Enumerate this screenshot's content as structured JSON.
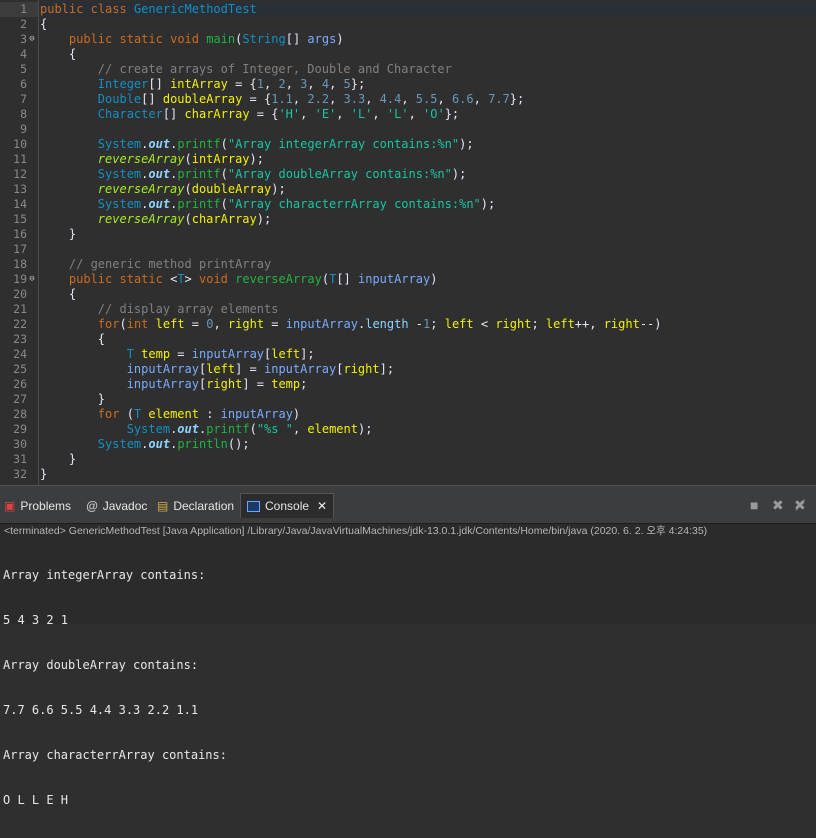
{
  "editor": {
    "lines": [
      {
        "n": "1",
        "tokens": [
          [
            "kw",
            "public"
          ],
          [
            "plain",
            " "
          ],
          [
            "kw",
            "class"
          ],
          [
            "plain",
            " "
          ],
          [
            "cls",
            "GenericMethodTest"
          ]
        ]
      },
      {
        "n": "2",
        "tokens": [
          [
            "plain",
            "{"
          ]
        ]
      },
      {
        "n": "3",
        "fold": "⊖",
        "tokens": [
          [
            "plain",
            "    "
          ],
          [
            "kw",
            "public"
          ],
          [
            "plain",
            " "
          ],
          [
            "kw",
            "static"
          ],
          [
            "plain",
            " "
          ],
          [
            "kw",
            "void"
          ],
          [
            "plain",
            " "
          ],
          [
            "fn",
            "main"
          ],
          [
            "plain",
            "("
          ],
          [
            "cls",
            "String"
          ],
          [
            "plain",
            "[] "
          ],
          [
            "par",
            "args"
          ],
          [
            "plain",
            ")"
          ]
        ]
      },
      {
        "n": "4",
        "tokens": [
          [
            "plain",
            "    {"
          ]
        ]
      },
      {
        "n": "5",
        "tokens": [
          [
            "plain",
            "        "
          ],
          [
            "cmt",
            "// create arrays of Integer, Double and Character"
          ]
        ]
      },
      {
        "n": "6",
        "tokens": [
          [
            "plain",
            "        "
          ],
          [
            "cls",
            "Integer"
          ],
          [
            "plain",
            "[] "
          ],
          [
            "var",
            "intArray"
          ],
          [
            "plain",
            " = {"
          ],
          [
            "num",
            "1"
          ],
          [
            "plain",
            ", "
          ],
          [
            "num",
            "2"
          ],
          [
            "plain",
            ", "
          ],
          [
            "num",
            "3"
          ],
          [
            "plain",
            ", "
          ],
          [
            "num",
            "4"
          ],
          [
            "plain",
            ", "
          ],
          [
            "num",
            "5"
          ],
          [
            "plain",
            "};"
          ]
        ]
      },
      {
        "n": "7",
        "tokens": [
          [
            "plain",
            "        "
          ],
          [
            "cls",
            "Double"
          ],
          [
            "plain",
            "[] "
          ],
          [
            "var",
            "doubleArray"
          ],
          [
            "plain",
            " = {"
          ],
          [
            "num",
            "1.1"
          ],
          [
            "plain",
            ", "
          ],
          [
            "num",
            "2.2"
          ],
          [
            "plain",
            ", "
          ],
          [
            "num",
            "3.3"
          ],
          [
            "plain",
            ", "
          ],
          [
            "num",
            "4.4"
          ],
          [
            "plain",
            ", "
          ],
          [
            "num",
            "5.5"
          ],
          [
            "plain",
            ", "
          ],
          [
            "num",
            "6.6"
          ],
          [
            "plain",
            ", "
          ],
          [
            "num",
            "7.7"
          ],
          [
            "plain",
            "};"
          ]
        ]
      },
      {
        "n": "8",
        "tokens": [
          [
            "plain",
            "        "
          ],
          [
            "cls",
            "Character"
          ],
          [
            "plain",
            "[] "
          ],
          [
            "var",
            "charArray"
          ],
          [
            "plain",
            " = {"
          ],
          [
            "str",
            "'H'"
          ],
          [
            "plain",
            ", "
          ],
          [
            "str",
            "'E'"
          ],
          [
            "plain",
            ", "
          ],
          [
            "str",
            "'L'"
          ],
          [
            "plain",
            ", "
          ],
          [
            "str",
            "'L'"
          ],
          [
            "plain",
            ", "
          ],
          [
            "str",
            "'O'"
          ],
          [
            "plain",
            "};"
          ]
        ]
      },
      {
        "n": "9",
        "tokens": []
      },
      {
        "n": "10",
        "tokens": [
          [
            "plain",
            "        "
          ],
          [
            "cls",
            "System"
          ],
          [
            "plain",
            "."
          ],
          [
            "stfld",
            "out"
          ],
          [
            "plain",
            "."
          ],
          [
            "fn",
            "printf"
          ],
          [
            "plain",
            "("
          ],
          [
            "str",
            "\"Array integerArray contains:%n\""
          ],
          [
            "plain",
            ");"
          ]
        ]
      },
      {
        "n": "11",
        "tokens": [
          [
            "plain",
            "        "
          ],
          [
            "stm",
            "reverseArray"
          ],
          [
            "plain",
            "("
          ],
          [
            "var",
            "intArray"
          ],
          [
            "plain",
            ");"
          ]
        ]
      },
      {
        "n": "12",
        "tokens": [
          [
            "plain",
            "        "
          ],
          [
            "cls",
            "System"
          ],
          [
            "plain",
            "."
          ],
          [
            "stfld",
            "out"
          ],
          [
            "plain",
            "."
          ],
          [
            "fn",
            "printf"
          ],
          [
            "plain",
            "("
          ],
          [
            "str",
            "\"Array doubleArray contains:%n\""
          ],
          [
            "plain",
            ");"
          ]
        ]
      },
      {
        "n": "13",
        "tokens": [
          [
            "plain",
            "        "
          ],
          [
            "stm",
            "reverseArray"
          ],
          [
            "plain",
            "("
          ],
          [
            "var",
            "doubleArray"
          ],
          [
            "plain",
            ");"
          ]
        ]
      },
      {
        "n": "14",
        "tokens": [
          [
            "plain",
            "        "
          ],
          [
            "cls",
            "System"
          ],
          [
            "plain",
            "."
          ],
          [
            "stfld",
            "out"
          ],
          [
            "plain",
            "."
          ],
          [
            "fn",
            "printf"
          ],
          [
            "plain",
            "("
          ],
          [
            "str",
            "\"Array characterrArray contains:%n\""
          ],
          [
            "plain",
            ");"
          ]
        ]
      },
      {
        "n": "15",
        "tokens": [
          [
            "plain",
            "        "
          ],
          [
            "stm",
            "reverseArray"
          ],
          [
            "plain",
            "("
          ],
          [
            "var",
            "charArray"
          ],
          [
            "plain",
            ");"
          ]
        ]
      },
      {
        "n": "16",
        "tokens": [
          [
            "plain",
            "    }"
          ]
        ]
      },
      {
        "n": "17",
        "tokens": []
      },
      {
        "n": "18",
        "tokens": [
          [
            "plain",
            "    "
          ],
          [
            "cmt",
            "// generic method printArray"
          ]
        ]
      },
      {
        "n": "19",
        "fold": "⊖",
        "tokens": [
          [
            "plain",
            "    "
          ],
          [
            "kw",
            "public"
          ],
          [
            "plain",
            " "
          ],
          [
            "kw",
            "static"
          ],
          [
            "plain",
            " <"
          ],
          [
            "cls",
            "T"
          ],
          [
            "plain",
            "> "
          ],
          [
            "kw",
            "void"
          ],
          [
            "plain",
            " "
          ],
          [
            "fn",
            "reverseArray"
          ],
          [
            "plain",
            "("
          ],
          [
            "cls",
            "T"
          ],
          [
            "plain",
            "[] "
          ],
          [
            "par",
            "inputArray"
          ],
          [
            "plain",
            ")"
          ]
        ]
      },
      {
        "n": "20",
        "tokens": [
          [
            "plain",
            "    {"
          ]
        ]
      },
      {
        "n": "21",
        "tokens": [
          [
            "plain",
            "        "
          ],
          [
            "cmt",
            "// display array elements"
          ]
        ]
      },
      {
        "n": "22",
        "tokens": [
          [
            "plain",
            "        "
          ],
          [
            "kw",
            "for"
          ],
          [
            "plain",
            "("
          ],
          [
            "kw",
            "int"
          ],
          [
            "plain",
            " "
          ],
          [
            "var",
            "left"
          ],
          [
            "plain",
            " = "
          ],
          [
            "num",
            "0"
          ],
          [
            "plain",
            ", "
          ],
          [
            "var",
            "right"
          ],
          [
            "plain",
            " = "
          ],
          [
            "par",
            "inputArray"
          ],
          [
            "plain",
            "."
          ],
          [
            "fld",
            "length"
          ],
          [
            "plain",
            " -"
          ],
          [
            "num",
            "1"
          ],
          [
            "plain",
            "; "
          ],
          [
            "var",
            "left"
          ],
          [
            "plain",
            " < "
          ],
          [
            "var",
            "right"
          ],
          [
            "plain",
            "; "
          ],
          [
            "var",
            "left"
          ],
          [
            "plain",
            "++, "
          ],
          [
            "var",
            "right"
          ],
          [
            "plain",
            "--)"
          ]
        ]
      },
      {
        "n": "23",
        "tokens": [
          [
            "plain",
            "        {"
          ]
        ]
      },
      {
        "n": "24",
        "tokens": [
          [
            "plain",
            "            "
          ],
          [
            "cls",
            "T"
          ],
          [
            "plain",
            " "
          ],
          [
            "var",
            "temp"
          ],
          [
            "plain",
            " = "
          ],
          [
            "par",
            "inputArray"
          ],
          [
            "plain",
            "["
          ],
          [
            "var",
            "left"
          ],
          [
            "plain",
            "];"
          ]
        ]
      },
      {
        "n": "25",
        "tokens": [
          [
            "plain",
            "            "
          ],
          [
            "par",
            "inputArray"
          ],
          [
            "plain",
            "["
          ],
          [
            "var",
            "left"
          ],
          [
            "plain",
            "] = "
          ],
          [
            "par",
            "inputArray"
          ],
          [
            "plain",
            "["
          ],
          [
            "var",
            "right"
          ],
          [
            "plain",
            "];"
          ]
        ]
      },
      {
        "n": "26",
        "tokens": [
          [
            "plain",
            "            "
          ],
          [
            "par",
            "inputArray"
          ],
          [
            "plain",
            "["
          ],
          [
            "var",
            "right"
          ],
          [
            "plain",
            "] = "
          ],
          [
            "var",
            "temp"
          ],
          [
            "plain",
            ";"
          ]
        ]
      },
      {
        "n": "27",
        "tokens": [
          [
            "plain",
            "        }"
          ]
        ]
      },
      {
        "n": "28",
        "tokens": [
          [
            "plain",
            "        "
          ],
          [
            "kw",
            "for"
          ],
          [
            "plain",
            " ("
          ],
          [
            "cls",
            "T"
          ],
          [
            "plain",
            " "
          ],
          [
            "var",
            "element"
          ],
          [
            "plain",
            " : "
          ],
          [
            "par",
            "inputArray"
          ],
          [
            "plain",
            ")"
          ]
        ]
      },
      {
        "n": "29",
        "tokens": [
          [
            "plain",
            "            "
          ],
          [
            "cls",
            "System"
          ],
          [
            "plain",
            "."
          ],
          [
            "stfld",
            "out"
          ],
          [
            "plain",
            "."
          ],
          [
            "fn",
            "printf"
          ],
          [
            "plain",
            "("
          ],
          [
            "str",
            "\"%s \""
          ],
          [
            "plain",
            ", "
          ],
          [
            "var",
            "element"
          ],
          [
            "plain",
            ");"
          ]
        ]
      },
      {
        "n": "30",
        "tokens": [
          [
            "plain",
            "        "
          ],
          [
            "cls",
            "System"
          ],
          [
            "plain",
            "."
          ],
          [
            "stfld",
            "out"
          ],
          [
            "plain",
            "."
          ],
          [
            "fn",
            "println"
          ],
          [
            "plain",
            "();"
          ]
        ]
      },
      {
        "n": "31",
        "tokens": [
          [
            "plain",
            "    }"
          ]
        ]
      },
      {
        "n": "32",
        "tokens": [
          [
            "plain",
            "}"
          ]
        ]
      }
    ]
  },
  "panel": {
    "tabs": [
      {
        "id": "problems",
        "label": "Problems",
        "icon": "problems-icon",
        "glyph": "▣"
      },
      {
        "id": "javadoc",
        "label": "Javadoc",
        "icon": "javadoc-icon",
        "glyph": "@"
      },
      {
        "id": "declaration",
        "label": "Declaration",
        "icon": "declaration-icon",
        "glyph": "▤"
      },
      {
        "id": "console",
        "label": "Console",
        "icon": "console-icon",
        "glyph": "",
        "active": true,
        "close": "✕"
      }
    ],
    "toolbar": {
      "minimize": "■",
      "remove": "✖",
      "remove_all": "✖̸"
    },
    "status": "<terminated> GenericMethodTest [Java Application] /Library/Java/JavaVirtualMachines/jdk-13.0.1.jdk/Contents/Home/bin/java (2020. 6. 2. 오후 4:24:35)",
    "console_lines": [
      "Array integerArray contains:",
      "5 4 3 2 1",
      "Array doubleArray contains:",
      "7.7 6.6 5.5 4.4 3.3 2.2 1.1",
      "Array characterrArray contains:",
      "O L L E H"
    ]
  }
}
